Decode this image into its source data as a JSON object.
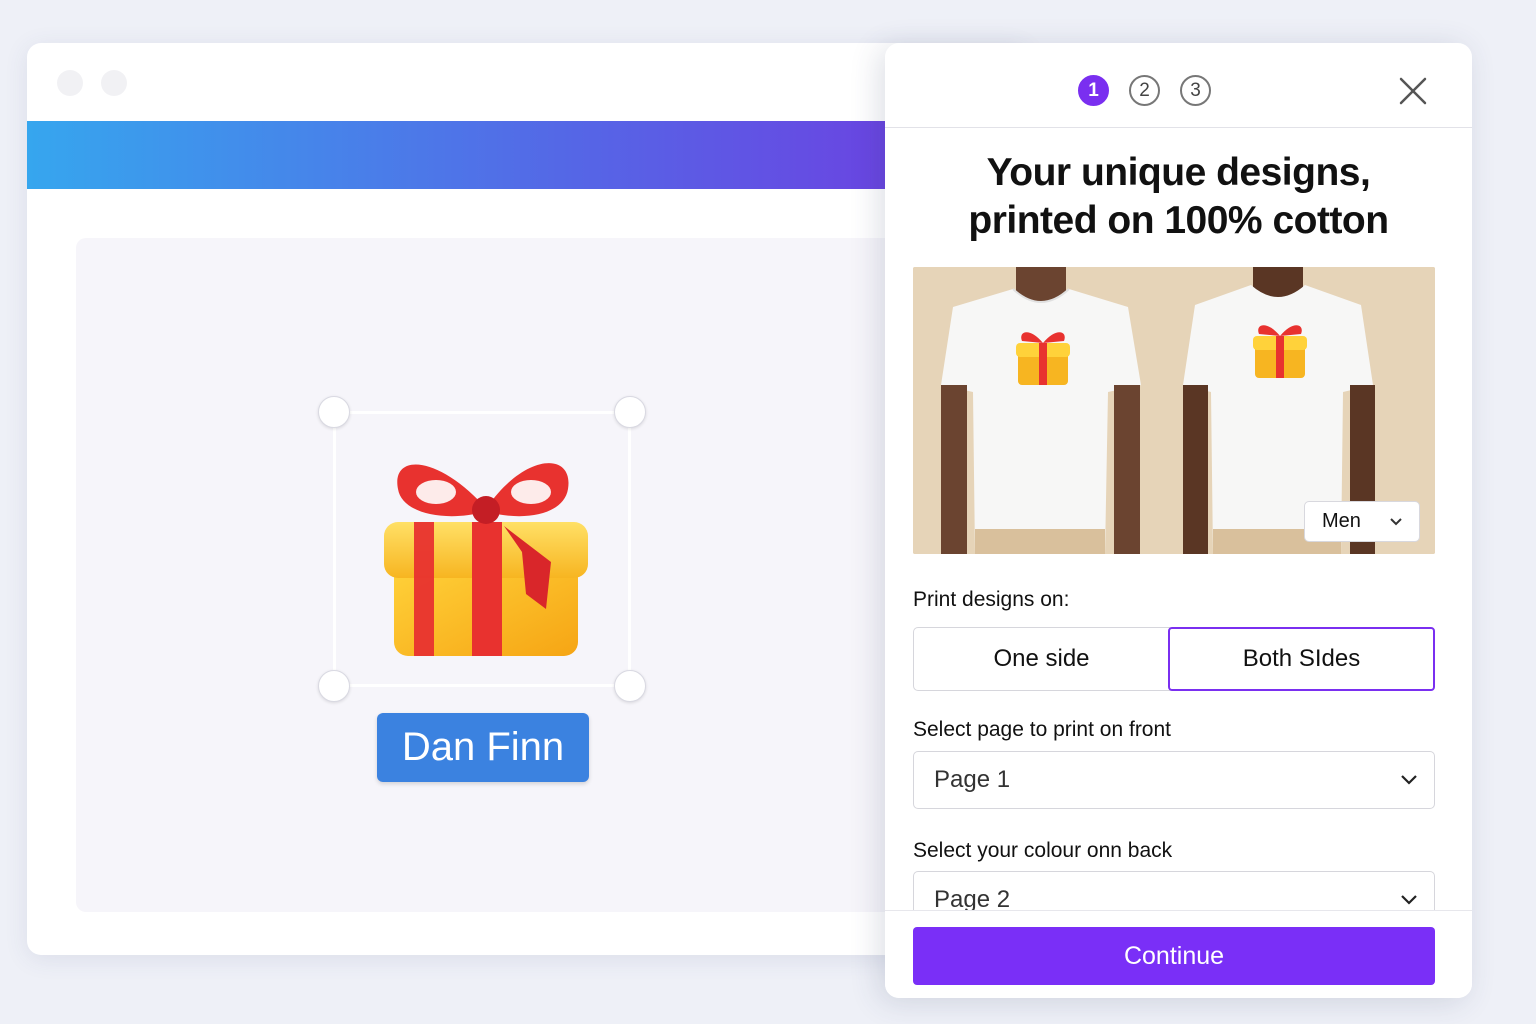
{
  "canvas": {
    "name_tag": "Dan Finn"
  },
  "panel": {
    "steps": [
      "1",
      "2",
      "3"
    ],
    "active_step": 1,
    "title_line1": "Your unique designs,",
    "title_line2": "printed on 100% cotton",
    "gender_select": "Men",
    "print_on_label": "Print designs on:",
    "option_one_side": "One side",
    "option_both_sides": "Both SIdes",
    "front_label": "Select page to print on front",
    "front_value": "Page 1",
    "back_label": "Select your colour onn back",
    "back_value": "Page 2",
    "continue_label": "Continue"
  },
  "colors": {
    "accent": "#7a2ff7",
    "gradient_start": "#36a6ee",
    "gradient_end": "#7336e0",
    "name_tag": "#3b82e0"
  }
}
